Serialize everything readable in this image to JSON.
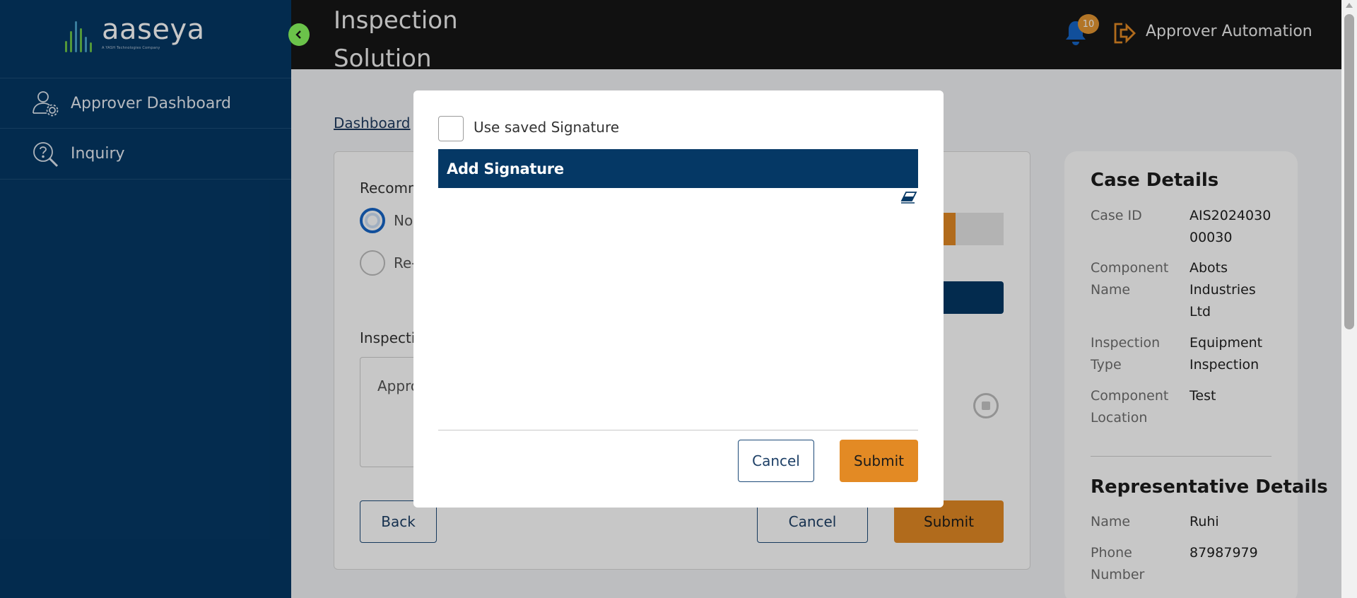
{
  "brand": {
    "name": "aaseya",
    "tagline": "A YASH Technologies Company"
  },
  "sidebar": {
    "items": [
      {
        "label": "Approver Dashboard",
        "icon": "user-gear-icon"
      },
      {
        "label": "Inquiry",
        "icon": "search-question-icon"
      }
    ]
  },
  "header": {
    "title_line1": "Inspection",
    "title_line2": "Solution",
    "notifications_count": "10",
    "user_name": "Approver Automation"
  },
  "breadcrumb": {
    "root": "Dashboard",
    "separator": ">"
  },
  "form": {
    "recommendation_label": "Recomm",
    "radio_no": "No",
    "radio_re": "Re-",
    "inspection_label": "Inspectio",
    "textarea_value": "Appro",
    "back": "Back",
    "cancel": "Cancel",
    "submit": "Submit"
  },
  "case_details": {
    "title": "Case Details",
    "rows": [
      {
        "k1": "Case ID",
        "k2": "",
        "v1": "AIS2024030",
        "v2": "00030",
        "v3": ""
      },
      {
        "k1": "Component",
        "k2": "Name",
        "v1": "Abots",
        "v2": "Industries",
        "v3": "Ltd"
      },
      {
        "k1": "Inspection",
        "k2": "Type",
        "v1": "Equipment",
        "v2": "Inspection",
        "v3": ""
      },
      {
        "k1": "Component",
        "k2": "Location",
        "v1": "Test",
        "v2": "",
        "v3": ""
      }
    ]
  },
  "representative_details": {
    "title": "Representative Details",
    "rows": [
      {
        "k1": "Name",
        "k2": "",
        "v1": "Ruhi"
      },
      {
        "k1": "Phone",
        "k2": "Number",
        "v1": "87987979"
      }
    ]
  },
  "modal": {
    "use_saved_label": "Use saved Signature",
    "use_saved_checked": false,
    "add_signature_title": "Add Signature",
    "cancel": "Cancel",
    "submit": "Submit"
  },
  "colors": {
    "sidebar": "#053865",
    "topbar": "#161616",
    "accent_orange": "#e38a24",
    "navy": "#053865",
    "green": "#6bc34a",
    "bell_blue": "#1766c7"
  }
}
